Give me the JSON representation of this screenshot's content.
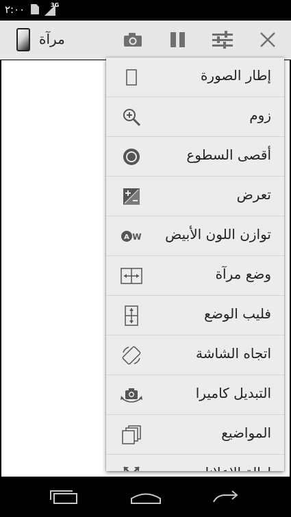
{
  "status_bar": {
    "time": "٢:٠٠",
    "network_label": "3G",
    "icons": [
      "sim-icon",
      "signal-icon"
    ]
  },
  "action_bar": {
    "title": "مرآة",
    "app_icon": "phone-frame-icon",
    "actions": [
      {
        "name": "camera-icon"
      },
      {
        "name": "pause-icon"
      },
      {
        "name": "settings-sliders-icon"
      },
      {
        "name": "close-icon"
      }
    ]
  },
  "menu": {
    "items": [
      {
        "label": "إطار الصورة",
        "icon": "photo-frame-icon"
      },
      {
        "label": "زوم",
        "icon": "zoom-in-icon"
      },
      {
        "label": "أقصى السطوع",
        "icon": "brightness-icon"
      },
      {
        "label": "تعرض",
        "icon": "exposure-icon"
      },
      {
        "label": "توازن اللون الأبيض",
        "icon": "white-balance-icon"
      },
      {
        "label": "وضع مرآة",
        "icon": "mirror-mode-icon"
      },
      {
        "label": "فليب الوضع",
        "icon": "flip-mode-icon"
      },
      {
        "label": "اتجاه الشاشة",
        "icon": "screen-rotation-icon"
      },
      {
        "label": "التبديل كاميرا",
        "icon": "switch-camera-icon"
      },
      {
        "label": "المواضيع",
        "icon": "themes-icon"
      },
      {
        "label": "إزالة الإعلانات",
        "icon": "remove-ads-icon"
      }
    ]
  },
  "nav_bar": {
    "buttons": [
      {
        "name": "recent-apps-icon"
      },
      {
        "name": "home-icon"
      },
      {
        "name": "back-icon"
      }
    ]
  }
}
